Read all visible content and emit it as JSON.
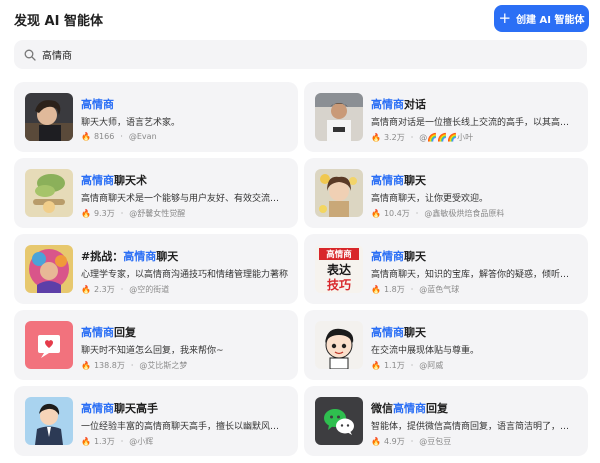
{
  "header": {
    "title": "发现 AI 智能体",
    "create_label": "创建 AI 智能体"
  },
  "search": {
    "value": "高情商",
    "placeholder": ""
  },
  "cards": [
    {
      "name_hl": "高情商",
      "name_rest": "",
      "desc": "聊天大师，语言艺术家。",
      "count": "8166",
      "author": "@Evan"
    },
    {
      "name_hl": "高情商",
      "name_rest": "对话",
      "desc": "高情商对话是一位擅长线上交流的高手，以其高超的沟通技巧著称",
      "count": "3.2万",
      "author": "@🌈🌈🌈小叶"
    },
    {
      "name_hl": "高情商",
      "name_rest": "聊天术",
      "desc": "高情商聊天术是一个能够与用户友好、有效交流的智能体",
      "count": "9.3万",
      "author": "@舒馨女性觉醒"
    },
    {
      "name_hl": "高情商",
      "name_rest": "聊天",
      "desc": "高情商聊天，让你更受欢迎。",
      "count": "10.4万",
      "author": "@鑫敏极烘焙食品原料"
    },
    {
      "name_prefix": "#挑战：",
      "name_hl": "高情商",
      "name_rest": "聊天",
      "desc": "心理学专家，以高情商沟通技巧和情绪管理能力著称",
      "count": "2.3万",
      "author": "@空的街道"
    },
    {
      "name_hl": "高情商",
      "name_rest": "聊天",
      "desc": "高情商聊天，知识的宝库，解答你的疑惑，倾听你的心声",
      "count": "1.8万",
      "author": "@蓝色气球"
    },
    {
      "name_hl": "高情商",
      "name_rest": "回复",
      "desc": "聊天时不知道怎么回复，我来帮你~",
      "count": "138.8万",
      "author": "@艾比斯之梦"
    },
    {
      "name_hl": "高情商",
      "name_rest": "聊天",
      "desc": "在交流中展现体贴与尊重。",
      "count": "1.1万",
      "author": "@阿威"
    },
    {
      "name_hl": "高情商",
      "name_rest": "聊天高手",
      "desc": "一位经验丰富的高情商聊天高手，擅长以幽默风趣的方式化解尴尬",
      "count": "1.3万",
      "author": "@小辉"
    },
    {
      "name_prefix": "微信",
      "name_hl": "高情商",
      "name_rest": "回复",
      "desc": "智能体，提供微信高情商回复，语言简洁明了，贴心自然",
      "count": "4.9万",
      "author": "@豆包豆"
    }
  ],
  "avatar_text": {
    "label1": "高情商",
    "label2": "表达",
    "label3": "技巧"
  },
  "colors": {
    "accent": "#2b6ff5",
    "card_bg": "#f4f4f6"
  }
}
